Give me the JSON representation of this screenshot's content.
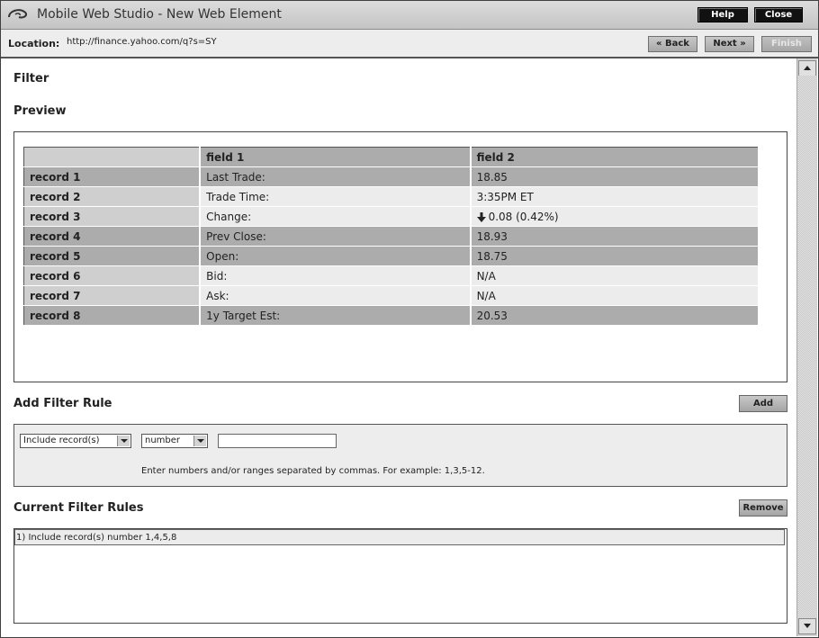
{
  "window": {
    "title": "Mobile Web Studio - New Web Element",
    "help_label": "Help",
    "close_label": "Close"
  },
  "location": {
    "label": "Location:",
    "url": "http://finance.yahoo.com/q?s=SY",
    "back_label": "« Back",
    "next_label": "Next »",
    "finish_label": "Finish"
  },
  "page": {
    "filter_heading": "Filter",
    "preview_heading": "Preview"
  },
  "preview_table": {
    "headers": [
      "",
      "field 1",
      "field 2"
    ],
    "rows": [
      {
        "record": "record 1",
        "field1": "Last Trade:",
        "field2": "18.85",
        "shade": "dark"
      },
      {
        "record": "record 2",
        "field1": "Trade Time:",
        "field2": "3:35PM ET",
        "shade": "light"
      },
      {
        "record": "record 3",
        "field1": "Change:",
        "field2": "0.08 (0.42%)",
        "shade": "light"
      },
      {
        "record": "record 4",
        "field1": "Prev Close:",
        "field2": "18.93",
        "shade": "dark"
      },
      {
        "record": "record 5",
        "field1": "Open:",
        "field2": "18.75",
        "shade": "dark"
      },
      {
        "record": "record 6",
        "field1": "Bid:",
        "field2": "N/A",
        "shade": "light"
      },
      {
        "record": "record 7",
        "field1": "Ask:",
        "field2": "N/A",
        "shade": "light"
      },
      {
        "record": "record 8",
        "field1": "1y Target Est:",
        "field2": "20.53",
        "shade": "dark"
      }
    ]
  },
  "add_filter": {
    "heading": "Add Filter Rule",
    "add_label": "Add",
    "mode_select": "Include record(s)",
    "type_select": "number",
    "value_input": "",
    "hint": "Enter numbers and/or ranges separated by commas. For example: 1,3,5-12."
  },
  "current_rules": {
    "heading": "Current Filter Rules",
    "remove_label": "Remove",
    "items": [
      "1) Include record(s) number 1,4,5,8"
    ]
  },
  "icons": {
    "app": "app-swirl-icon",
    "change_direction": "down-arrow-icon"
  },
  "colors": {
    "dark_row": "#acacac",
    "light_row": "#ececec",
    "panel": "#ededed"
  }
}
